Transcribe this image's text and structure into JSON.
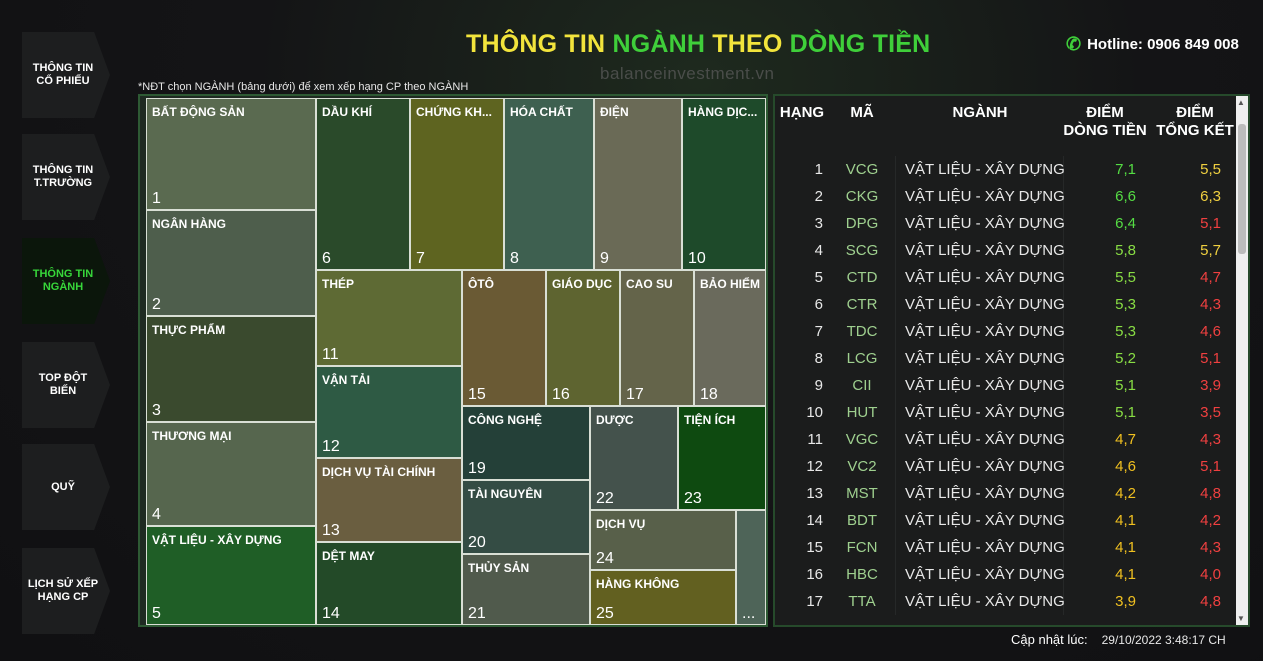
{
  "nav": [
    {
      "label": "THÔNG TIN CỔ PHIẾU",
      "active": false
    },
    {
      "label": "THÔNG TIN T.TRƯỜNG",
      "active": false
    },
    {
      "label": "THÔNG TIN NGÀNH",
      "active": true
    },
    {
      "label": "TOP ĐỘT BIẾN",
      "active": false
    },
    {
      "label": "QUỸ",
      "active": false
    },
    {
      "label": "LỊCH SỬ XẾP HẠNG CP",
      "active": false
    }
  ],
  "title": {
    "part1": "THÔNG TIN ",
    "part2": "NGÀNH ",
    "part3": "THEO ",
    "part4": "DÒNG TIỀN"
  },
  "hotline": "Hotline: 0906 849 008",
  "watermark": "balanceinvestment.vn",
  "note": "*NĐT chọn NGÀNH (bảng dưới) để xem xếp hạng CP theo NGÀNH",
  "colors": {
    "accent_green": "#3fcf3a",
    "accent_yellow": "#f2e43c",
    "score_high": "#55dd44",
    "score_mid": "#f0c020",
    "score_low": "#f04040"
  },
  "treemap": [
    {
      "label": "BẤT ĐỘNG SẢN",
      "rank": "1",
      "color": "#5a6a50"
    },
    {
      "label": "NGÂN HÀNG",
      "rank": "2",
      "color": "#4e5e4c"
    },
    {
      "label": "THỰC PHẨM",
      "rank": "3",
      "color": "#3a4a2e"
    },
    {
      "label": "THƯƠNG MẠI",
      "rank": "4",
      "color": "#56664e"
    },
    {
      "label": "VẬT LIỆU - XÂY DỰNG",
      "rank": "5",
      "color": "#1f5e26"
    },
    {
      "label": "DẦU KHÍ",
      "rank": "6",
      "color": "#2a4a2a"
    },
    {
      "label": "CHỨNG KH...",
      "rank": "7",
      "color": "#5e6420"
    },
    {
      "label": "HÓA CHẤT",
      "rank": "8",
      "color": "#3e6050"
    },
    {
      "label": "ĐIỆN",
      "rank": "9",
      "color": "#6a6a56"
    },
    {
      "label": "HÀNG DỊC...",
      "rank": "10",
      "color": "#1e4a2a"
    },
    {
      "label": "THÉP",
      "rank": "11",
      "color": "#5e6a34"
    },
    {
      "label": "VẬN TẢI",
      "rank": "12",
      "color": "#2e5a44"
    },
    {
      "label": "DỊCH VỤ TÀI CHÍNH",
      "rank": "13",
      "color": "#6a5e40"
    },
    {
      "label": "DỆT MAY",
      "rank": "14",
      "color": "#234a28"
    },
    {
      "label": "ÔTÔ",
      "rank": "15",
      "color": "#6a5a34"
    },
    {
      "label": "GIÁO DỤC",
      "rank": "16",
      "color": "#5e6430"
    },
    {
      "label": "CAO SU",
      "rank": "17",
      "color": "#64644a"
    },
    {
      "label": "BẢO HIỂM",
      "rank": "18",
      "color": "#6a6a5c"
    },
    {
      "label": "CÔNG NGHỆ",
      "rank": "19",
      "color": "#244038"
    },
    {
      "label": "TÀI NGUYÊN",
      "rank": "20",
      "color": "#344c44"
    },
    {
      "label": "THỦY SẢN",
      "rank": "21",
      "color": "#505a4c"
    },
    {
      "label": "DƯỢC",
      "rank": "22",
      "color": "#44524c"
    },
    {
      "label": "TIỆN ÍCH",
      "rank": "23",
      "color": "#0e4a10"
    },
    {
      "label": "DỊCH VỤ",
      "rank": "24",
      "color": "#58604a"
    },
    {
      "label": "HÀNG KHÔNG",
      "rank": "25",
      "color": "#626020"
    },
    {
      "label": "",
      "rank": "...",
      "color": "#4e6458"
    }
  ],
  "table": {
    "headers": {
      "rank": "HẠNG",
      "code": "MÃ",
      "industry": "NGÀNH",
      "cashflow": "ĐIỂM DÒNG TIỀN",
      "total": "ĐIỂM TỔNG KẾT"
    },
    "rows": [
      {
        "rank": "1",
        "code": "VCG",
        "industry": "VẬT LIỆU - XÂY DỰNG",
        "cashflow": "7,1",
        "total": "5,5",
        "cf_color": "#55dd44",
        "tk_color": "#f0d040"
      },
      {
        "rank": "2",
        "code": "CKG",
        "industry": "VẬT LIỆU - XÂY DỰNG",
        "cashflow": "6,6",
        "total": "6,3",
        "cf_color": "#55dd44",
        "tk_color": "#f0d040"
      },
      {
        "rank": "3",
        "code": "DPG",
        "industry": "VẬT LIỆU - XÂY DỰNG",
        "cashflow": "6,4",
        "total": "5,1",
        "cf_color": "#55dd44",
        "tk_color": "#f04040"
      },
      {
        "rank": "4",
        "code": "SCG",
        "industry": "VẬT LIỆU - XÂY DỰNG",
        "cashflow": "5,8",
        "total": "5,7",
        "cf_color": "#88dd44",
        "tk_color": "#f0d040"
      },
      {
        "rank": "5",
        "code": "CTD",
        "industry": "VẬT LIỆU - XÂY DỰNG",
        "cashflow": "5,5",
        "total": "4,7",
        "cf_color": "#88dd44",
        "tk_color": "#f04040"
      },
      {
        "rank": "6",
        "code": "CTR",
        "industry": "VẬT LIỆU - XÂY DỰNG",
        "cashflow": "5,3",
        "total": "4,3",
        "cf_color": "#88dd44",
        "tk_color": "#f04040"
      },
      {
        "rank": "7",
        "code": "TDC",
        "industry": "VẬT LIỆU - XÂY DỰNG",
        "cashflow": "5,3",
        "total": "4,6",
        "cf_color": "#88dd44",
        "tk_color": "#f04040"
      },
      {
        "rank": "8",
        "code": "LCG",
        "industry": "VẬT LIỆU - XÂY DỰNG",
        "cashflow": "5,2",
        "total": "5,1",
        "cf_color": "#88dd44",
        "tk_color": "#f04040"
      },
      {
        "rank": "9",
        "code": "CII",
        "industry": "VẬT LIỆU - XÂY DỰNG",
        "cashflow": "5,1",
        "total": "3,9",
        "cf_color": "#88dd44",
        "tk_color": "#f04040"
      },
      {
        "rank": "10",
        "code": "HUT",
        "industry": "VẬT LIỆU - XÂY DỰNG",
        "cashflow": "5,1",
        "total": "3,5",
        "cf_color": "#88dd44",
        "tk_color": "#f04040"
      },
      {
        "rank": "11",
        "code": "VGC",
        "industry": "VẬT LIỆU - XÂY DỰNG",
        "cashflow": "4,7",
        "total": "4,3",
        "cf_color": "#f0c020",
        "tk_color": "#f04040"
      },
      {
        "rank": "12",
        "code": "VC2",
        "industry": "VẬT LIỆU - XÂY DỰNG",
        "cashflow": "4,6",
        "total": "5,1",
        "cf_color": "#f0c020",
        "tk_color": "#f04040"
      },
      {
        "rank": "13",
        "code": "MST",
        "industry": "VẬT LIỆU - XÂY DỰNG",
        "cashflow": "4,2",
        "total": "4,8",
        "cf_color": "#f0c020",
        "tk_color": "#f04040"
      },
      {
        "rank": "14",
        "code": "BDT",
        "industry": "VẬT LIỆU - XÂY DỰNG",
        "cashflow": "4,1",
        "total": "4,2",
        "cf_color": "#f0c020",
        "tk_color": "#f04040"
      },
      {
        "rank": "15",
        "code": "FCN",
        "industry": "VẬT LIỆU - XÂY DỰNG",
        "cashflow": "4,1",
        "total": "4,3",
        "cf_color": "#f0c020",
        "tk_color": "#f04040"
      },
      {
        "rank": "16",
        "code": "HBC",
        "industry": "VẬT LIỆU - XÂY DỰNG",
        "cashflow": "4,1",
        "total": "4,0",
        "cf_color": "#f0c020",
        "tk_color": "#f04040"
      },
      {
        "rank": "17",
        "code": "TTA",
        "industry": "VẬT LIỆU - XÂY DỰNG",
        "cashflow": "3,9",
        "total": "4,8",
        "cf_color": "#f0c020",
        "tk_color": "#f04040"
      }
    ]
  },
  "updated": {
    "label": "Cập nhật lúc:",
    "timestamp": "29/10/2022 3:48:17 CH"
  }
}
